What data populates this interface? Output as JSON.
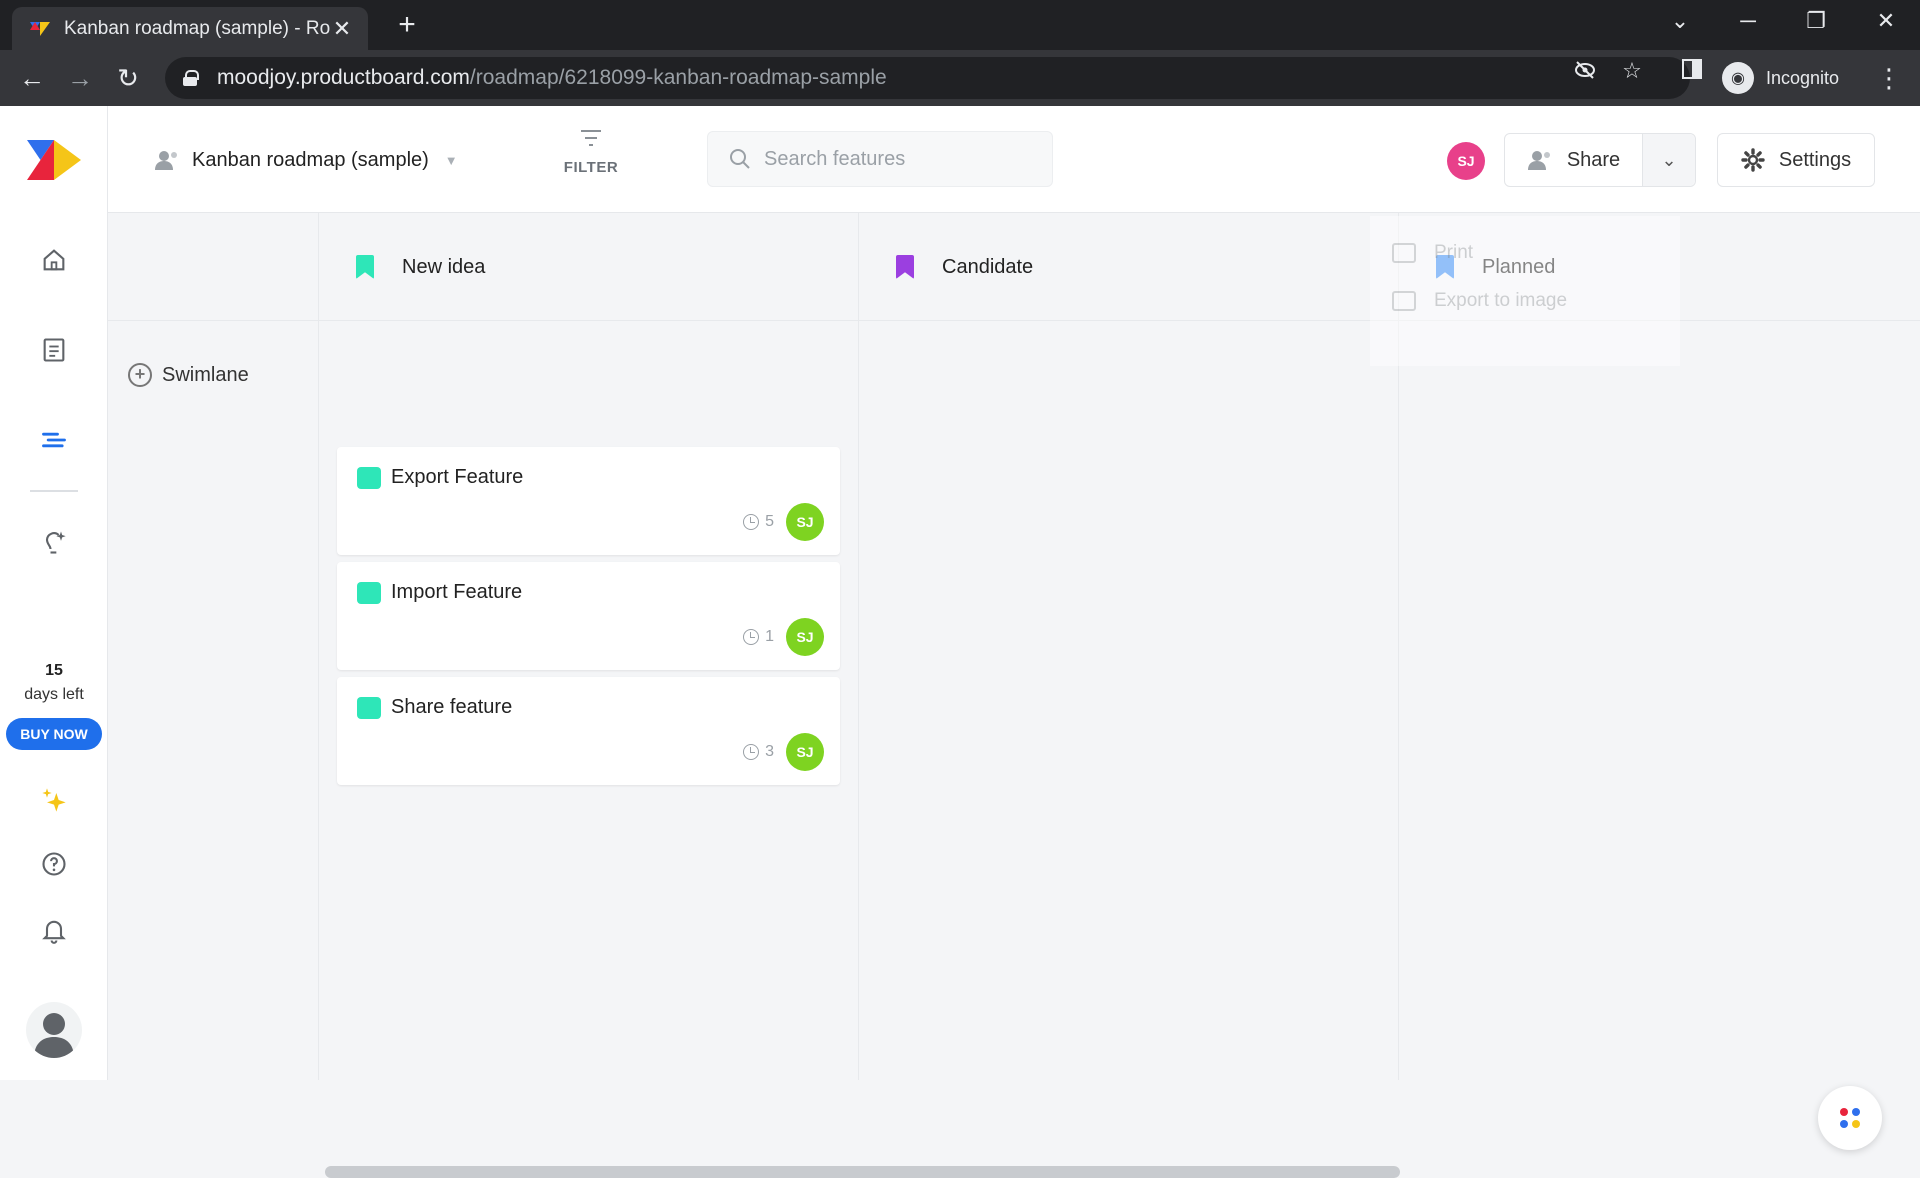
{
  "browser": {
    "tab_title": "Kanban roadmap (sample) - Roa",
    "url_host": "moodjoy.productboard.com",
    "url_path": "/roadmap/6218099-kanban-roadmap-sample",
    "profile_label": "Incognito"
  },
  "sidebar": {
    "trial_days": "15",
    "trial_text": "days left",
    "buy_label": "BUY NOW"
  },
  "header": {
    "roadmap_name": "Kanban roadmap (sample)",
    "filter_label": "FILTER",
    "search_placeholder": "Search features",
    "user_initials": "SJ",
    "share_label": "Share",
    "settings_label": "Settings"
  },
  "board": {
    "swimlane_label": "Swimlane",
    "columns": [
      {
        "name": "New idea",
        "color": "#2ee6b8"
      },
      {
        "name": "Candidate",
        "color": "#9b3fe0"
      },
      {
        "name": "Planned",
        "color": "#3b8cf5"
      }
    ],
    "cards": [
      {
        "title": "Export Feature",
        "count": "5",
        "initials": "SJ",
        "color": "#2ee6b8"
      },
      {
        "title": "Import Feature",
        "count": "1",
        "initials": "SJ",
        "color": "#2ee6b8"
      },
      {
        "title": "Share feature",
        "count": "3",
        "initials": "SJ",
        "color": "#2ee6b8"
      }
    ]
  },
  "share_menu": {
    "items": [
      "Print",
      "Export to image"
    ]
  },
  "colors": {
    "accent": "#1f6feb",
    "avatar_pink": "#e8408a",
    "avatar_green": "#7ed321"
  }
}
